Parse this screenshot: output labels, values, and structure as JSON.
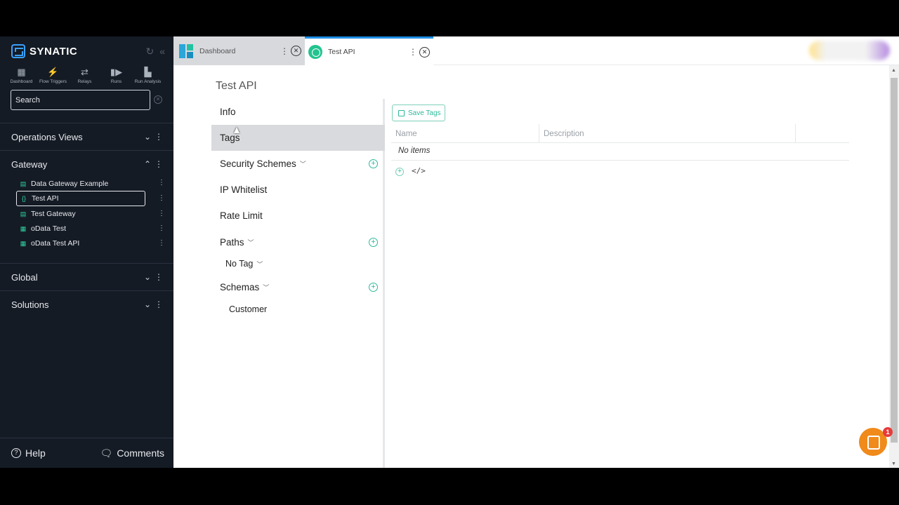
{
  "brand": {
    "name": "SYNATIC"
  },
  "quicknav": [
    {
      "label": "Dashboard",
      "icon": "grid-icon",
      "glyph": "▦"
    },
    {
      "label": "Flow Triggers",
      "icon": "bolt-icon",
      "glyph": "⚡"
    },
    {
      "label": "Relays",
      "icon": "relay-icon",
      "glyph": "⇄"
    },
    {
      "label": "Runs",
      "icon": "runs-icon",
      "glyph": "▮▶"
    },
    {
      "label": "Run Analysis",
      "icon": "analysis-icon",
      "glyph": "▙"
    }
  ],
  "search": {
    "placeholder": "Search"
  },
  "sections": {
    "operations": "Operations Views",
    "gateway": "Gateway",
    "global": "Global",
    "solutions": "Solutions"
  },
  "gateway_items": [
    {
      "label": "Data Gateway Example",
      "icon": "database-icon"
    },
    {
      "label": "Test API",
      "icon": "braces-icon",
      "active": true
    },
    {
      "label": "Test Gateway",
      "icon": "database-icon"
    },
    {
      "label": "oData Test",
      "icon": "table-icon"
    },
    {
      "label": "oData Test API",
      "icon": "table-icon"
    }
  ],
  "footer": {
    "help": "Help",
    "comments": "Comments"
  },
  "tabs": [
    {
      "label": "Dashboard",
      "active": false
    },
    {
      "label": "Test API",
      "active": true
    }
  ],
  "page": {
    "title": "Test API"
  },
  "menu": {
    "info": "Info",
    "tags": "Tags",
    "security": "Security Schemes",
    "ip": "IP Whitelist",
    "rate": "Rate Limit",
    "paths": "Paths",
    "no_tag": "No Tag",
    "schemas": "Schemas",
    "customer": "Customer"
  },
  "tags_panel": {
    "save": "Save Tags",
    "col_name": "Name",
    "col_description": "Description",
    "empty": "No items",
    "code_toggle": "</>"
  },
  "chat": {
    "badge": "1"
  },
  "colors": {
    "accent": "#2eb89a",
    "sidebar": "#151b24",
    "tab_active": "#1f8fe5",
    "chat": "#f08a1a"
  }
}
